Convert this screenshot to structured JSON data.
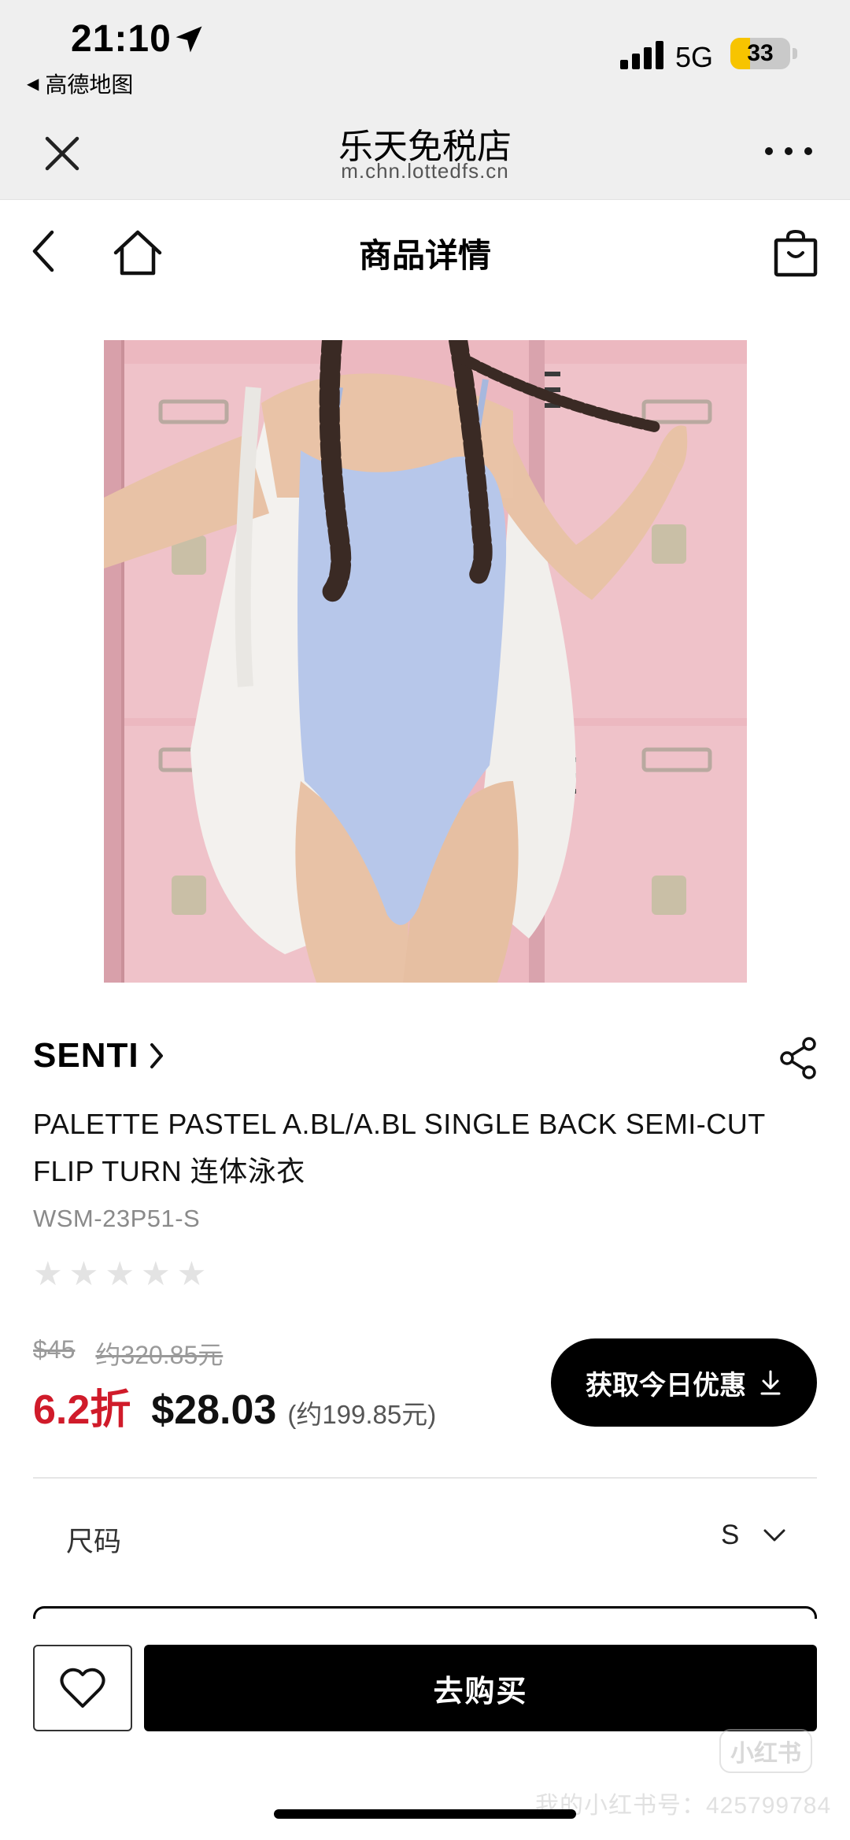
{
  "status_bar": {
    "time": "21:10",
    "back_app": "高德地图",
    "network": "5G",
    "battery": "33",
    "battery_level": 0.33
  },
  "browser": {
    "title": "乐天免税店",
    "url": "m.chn.lottedfs.cn"
  },
  "page": {
    "title": "商品详情"
  },
  "product": {
    "brand": "SENTI",
    "name": "PALETTE PASTEL A.BL/A.BL SINGLE BACK SEMI-CUT FLIP TURN 连体泳衣",
    "sku": "WSM-23P51-S",
    "rating_stars": 5,
    "rating_filled": 0,
    "original_price_usd": "$45",
    "original_price_cny": "约320.85元",
    "discount": "6.2折",
    "price_usd": "$28.03",
    "price_cny": "(约199.85元)",
    "coupon_label": "获取今日优惠"
  },
  "options": {
    "size_label": "尺码",
    "size_value": "S"
  },
  "bottom_bar": {
    "buy_label": "去购买"
  },
  "watermark": {
    "logo": "小红书",
    "text": "我的小红书号：425799784"
  },
  "colors": {
    "discount": "#d01b2a",
    "button": "#000000",
    "battery": "#f7c400"
  }
}
